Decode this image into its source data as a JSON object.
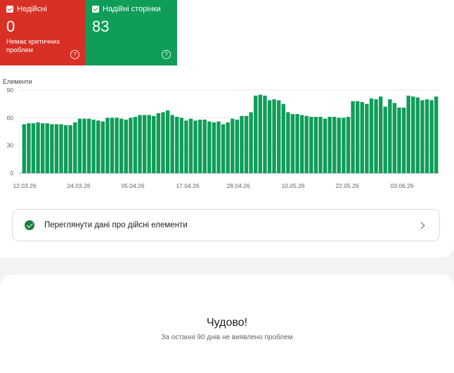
{
  "cards": {
    "invalid": {
      "label": "Недійсні",
      "count": "0",
      "subtitle": "Немає критичних проблем",
      "help": "?"
    },
    "valid": {
      "label": "Надійні сторінки",
      "count": "83",
      "help": "?"
    }
  },
  "link": {
    "label": "Переглянути дані про дійсні елементи"
  },
  "status": {
    "title": "Чудово!",
    "subtitle": "За останні 90 днів не виявлено проблем"
  },
  "colors": {
    "invalid": "#d93025",
    "valid": "#0f9d58",
    "bar": "#0f9d58"
  },
  "chart_data": {
    "type": "bar",
    "ylabel": "Елементи",
    "ylim": [
      0,
      90
    ],
    "yticks": [
      0,
      30,
      60,
      90
    ],
    "xtick_labels": [
      "12.03.26",
      "24.03.26",
      "05.04.26",
      "17.04.26",
      "28.04.26",
      "10.05.26",
      "22.05.26",
      "03.06.26"
    ],
    "values": [
      53,
      54,
      54,
      55,
      54,
      54,
      53,
      53,
      53,
      52,
      52,
      55,
      59,
      59,
      59,
      58,
      57,
      56,
      60,
      60,
      60,
      59,
      58,
      60,
      61,
      63,
      63,
      63,
      62,
      65,
      66,
      68,
      63,
      61,
      60,
      57,
      59,
      57,
      58,
      58,
      56,
      55,
      56,
      53,
      55,
      59,
      58,
      62,
      62,
      66,
      84,
      85,
      84,
      79,
      80,
      79,
      75,
      66,
      64,
      64,
      63,
      62,
      61,
      61,
      61,
      59,
      61,
      61,
      60,
      60,
      61,
      78,
      78,
      77,
      75,
      81,
      80,
      83,
      72,
      80,
      76,
      71,
      71,
      84,
      83,
      82,
      79,
      80,
      79,
      83
    ]
  }
}
